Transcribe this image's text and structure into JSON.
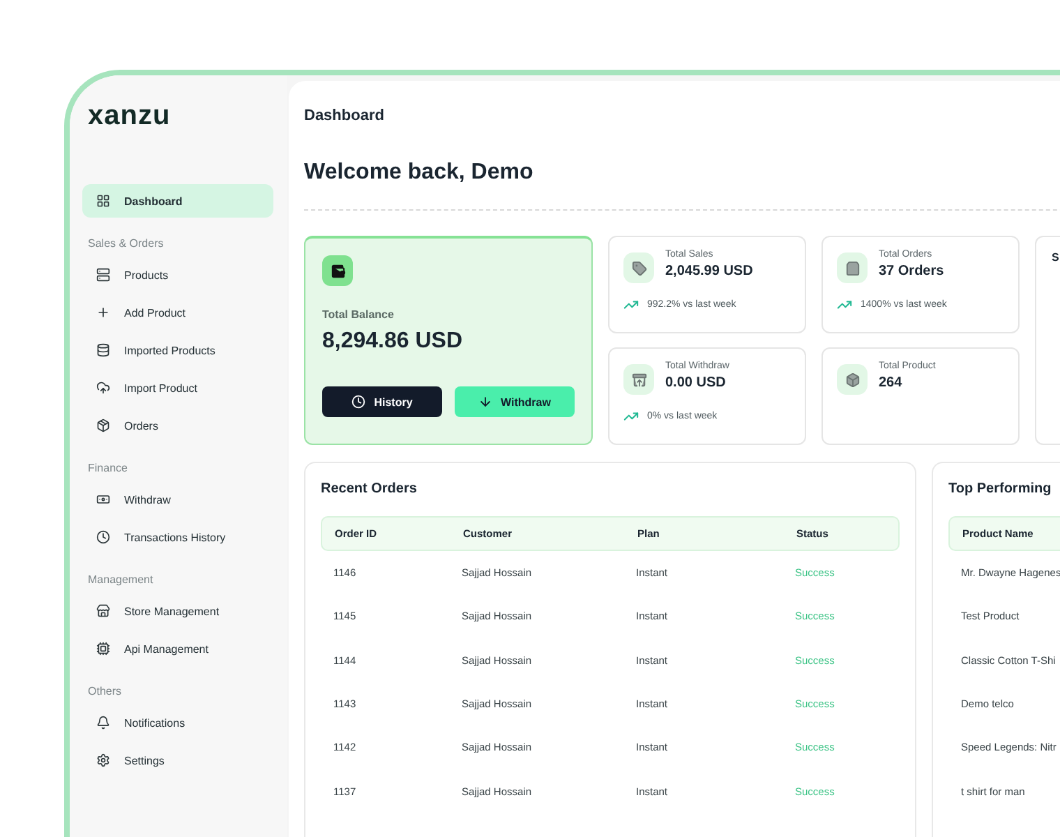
{
  "logo": "xanzu",
  "sidebar": {
    "sections": [
      {
        "items": [
          {
            "label": "Dashboard",
            "selected": true
          }
        ]
      },
      {
        "title": "Sales & Orders",
        "items": [
          {
            "label": "Products",
            "selected": false
          },
          {
            "label": "Add Product",
            "selected": false
          },
          {
            "label": "Imported Products",
            "selected": false
          },
          {
            "label": "Import Product",
            "selected": false
          },
          {
            "label": "Orders",
            "selected": false
          }
        ]
      },
      {
        "title": "Finance",
        "items": [
          {
            "label": "Withdraw",
            "selected": false
          },
          {
            "label": "Transactions History",
            "selected": false
          }
        ]
      },
      {
        "title": "Management",
        "items": [
          {
            "label": "Store Management",
            "selected": false
          },
          {
            "label": "Api Management",
            "selected": false
          }
        ]
      },
      {
        "title": "Others",
        "items": [
          {
            "label": "Notifications",
            "selected": false
          },
          {
            "label": "Settings",
            "selected": false
          }
        ]
      }
    ]
  },
  "breadcrumb": "Dashboard",
  "heading": "Welcome back, Demo",
  "balance": {
    "label": "Total Balance",
    "amount": "8,294.86 USD",
    "buttons": [
      {
        "label": "History",
        "kind": "dark"
      },
      {
        "label": "Withdraw",
        "kind": "accent"
      }
    ]
  },
  "stats": [
    {
      "label": "Total Sales",
      "value": "2,045.99 USD",
      "change": "992.2% vs last week"
    },
    {
      "label": "Total Orders",
      "value": "37 Orders",
      "change": "1400% vs last week"
    },
    {
      "label": "Total Withdraw",
      "value": "0.00 USD",
      "change": "0% vs last week"
    },
    {
      "label": "Total Product",
      "value": "264"
    }
  ],
  "side_card": {
    "title": "S"
  },
  "recent_orders": {
    "title": "Recent Orders",
    "columns": [
      "Order ID",
      "Customer",
      "Plan",
      "Status"
    ],
    "rows": [
      [
        "1146",
        "Sajjad Hossain",
        "Instant",
        "Success"
      ],
      [
        "1145",
        "Sajjad Hossain",
        "Instant",
        "Success"
      ],
      [
        "1144",
        "Sajjad Hossain",
        "Instant",
        "Success"
      ],
      [
        "1143",
        "Sajjad Hossain",
        "Instant",
        "Success"
      ],
      [
        "1142",
        "Sajjad Hossain",
        "Instant",
        "Success"
      ],
      [
        "1137",
        "Sajjad Hossain",
        "Instant",
        "Success"
      ]
    ]
  },
  "top_products": {
    "title": "Top Performing",
    "columns": [
      "Product Name"
    ],
    "rows": [
      [
        "Mr. Dwayne Hagenes"
      ],
      [
        "Test Product"
      ],
      [
        "Classic Cotton T-Shi"
      ],
      [
        "Demo telco"
      ],
      [
        "Speed Legends: Nitr"
      ],
      [
        "t shirt for man"
      ]
    ]
  }
}
